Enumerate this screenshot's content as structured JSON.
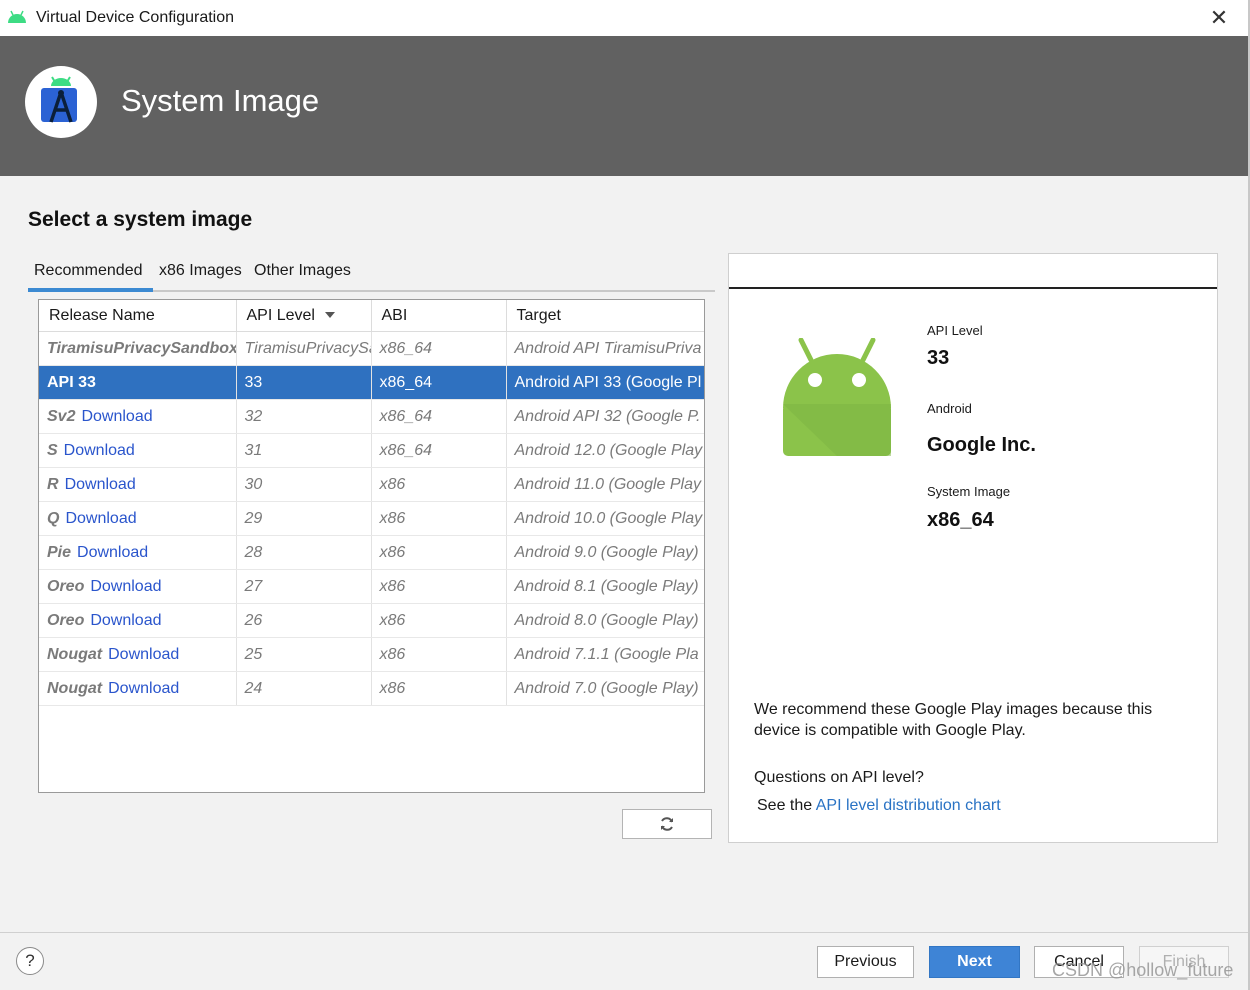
{
  "window": {
    "title": "Virtual Device Configuration",
    "close_glyph": "✕"
  },
  "header": {
    "title": "System Image"
  },
  "page": {
    "section_title": "Select a system image"
  },
  "tabs": [
    {
      "label": "Recommended",
      "active": true
    },
    {
      "label": "x86 Images",
      "active": false
    },
    {
      "label": "Other Images",
      "active": false
    }
  ],
  "table": {
    "columns": [
      "Release Name",
      "API Level",
      "ABI",
      "Target"
    ],
    "download_label": "Download",
    "rows": [
      {
        "name": "TiramisuPrivacySandbox",
        "download": false,
        "api": "TiramisuPrivacySa",
        "abi": "x86_64",
        "target": "Android API TiramisuPriva",
        "selected": false
      },
      {
        "name": "API 33",
        "download": false,
        "api": "33",
        "abi": "x86_64",
        "target": "Android API 33 (Google Pl",
        "selected": true
      },
      {
        "name": "Sv2",
        "download": true,
        "api": "32",
        "abi": "x86_64",
        "target": "Android API 32 (Google P.",
        "selected": false
      },
      {
        "name": "S",
        "download": true,
        "api": "31",
        "abi": "x86_64",
        "target": "Android 12.0 (Google Play",
        "selected": false
      },
      {
        "name": "R",
        "download": true,
        "api": "30",
        "abi": "x86",
        "target": "Android 11.0 (Google Play",
        "selected": false
      },
      {
        "name": "Q",
        "download": true,
        "api": "29",
        "abi": "x86",
        "target": "Android 10.0 (Google Play",
        "selected": false
      },
      {
        "name": "Pie",
        "download": true,
        "api": "28",
        "abi": "x86",
        "target": "Android 9.0 (Google Play)",
        "selected": false
      },
      {
        "name": "Oreo",
        "download": true,
        "api": "27",
        "abi": "x86",
        "target": "Android 8.1 (Google Play)",
        "selected": false
      },
      {
        "name": "Oreo",
        "download": true,
        "api": "26",
        "abi": "x86",
        "target": "Android 8.0 (Google Play)",
        "selected": false
      },
      {
        "name": "Nougat",
        "download": true,
        "api": "25",
        "abi": "x86",
        "target": "Android 7.1.1 (Google Pla",
        "selected": false
      },
      {
        "name": "Nougat",
        "download": true,
        "api": "24",
        "abi": "x86",
        "target": "Android 7.0 (Google Play)",
        "selected": false
      }
    ]
  },
  "refresh": {
    "icon": "refresh-icon"
  },
  "details": {
    "api_level_label": "API Level",
    "api_level": "33",
    "vendor_label": "Android",
    "vendor": "Google Inc.",
    "system_image_label": "System Image",
    "system_image": "x86_64",
    "recommendation": "We recommend these Google Play images because this device is compatible with Google Play.",
    "question": "Questions on API level?",
    "see_prefix": "See the ",
    "link_text": "API level distribution chart"
  },
  "footer": {
    "help": "?",
    "previous": "Previous",
    "next": "Next",
    "cancel": "Cancel",
    "finish": "Finish"
  },
  "watermark": "CSDN @hollow_future",
  "colors": {
    "selection": "#2f71c0",
    "header_bg": "#616161",
    "link": "#2a55cc",
    "android_green": "#8bc34a",
    "next_button": "#3e84d6"
  }
}
